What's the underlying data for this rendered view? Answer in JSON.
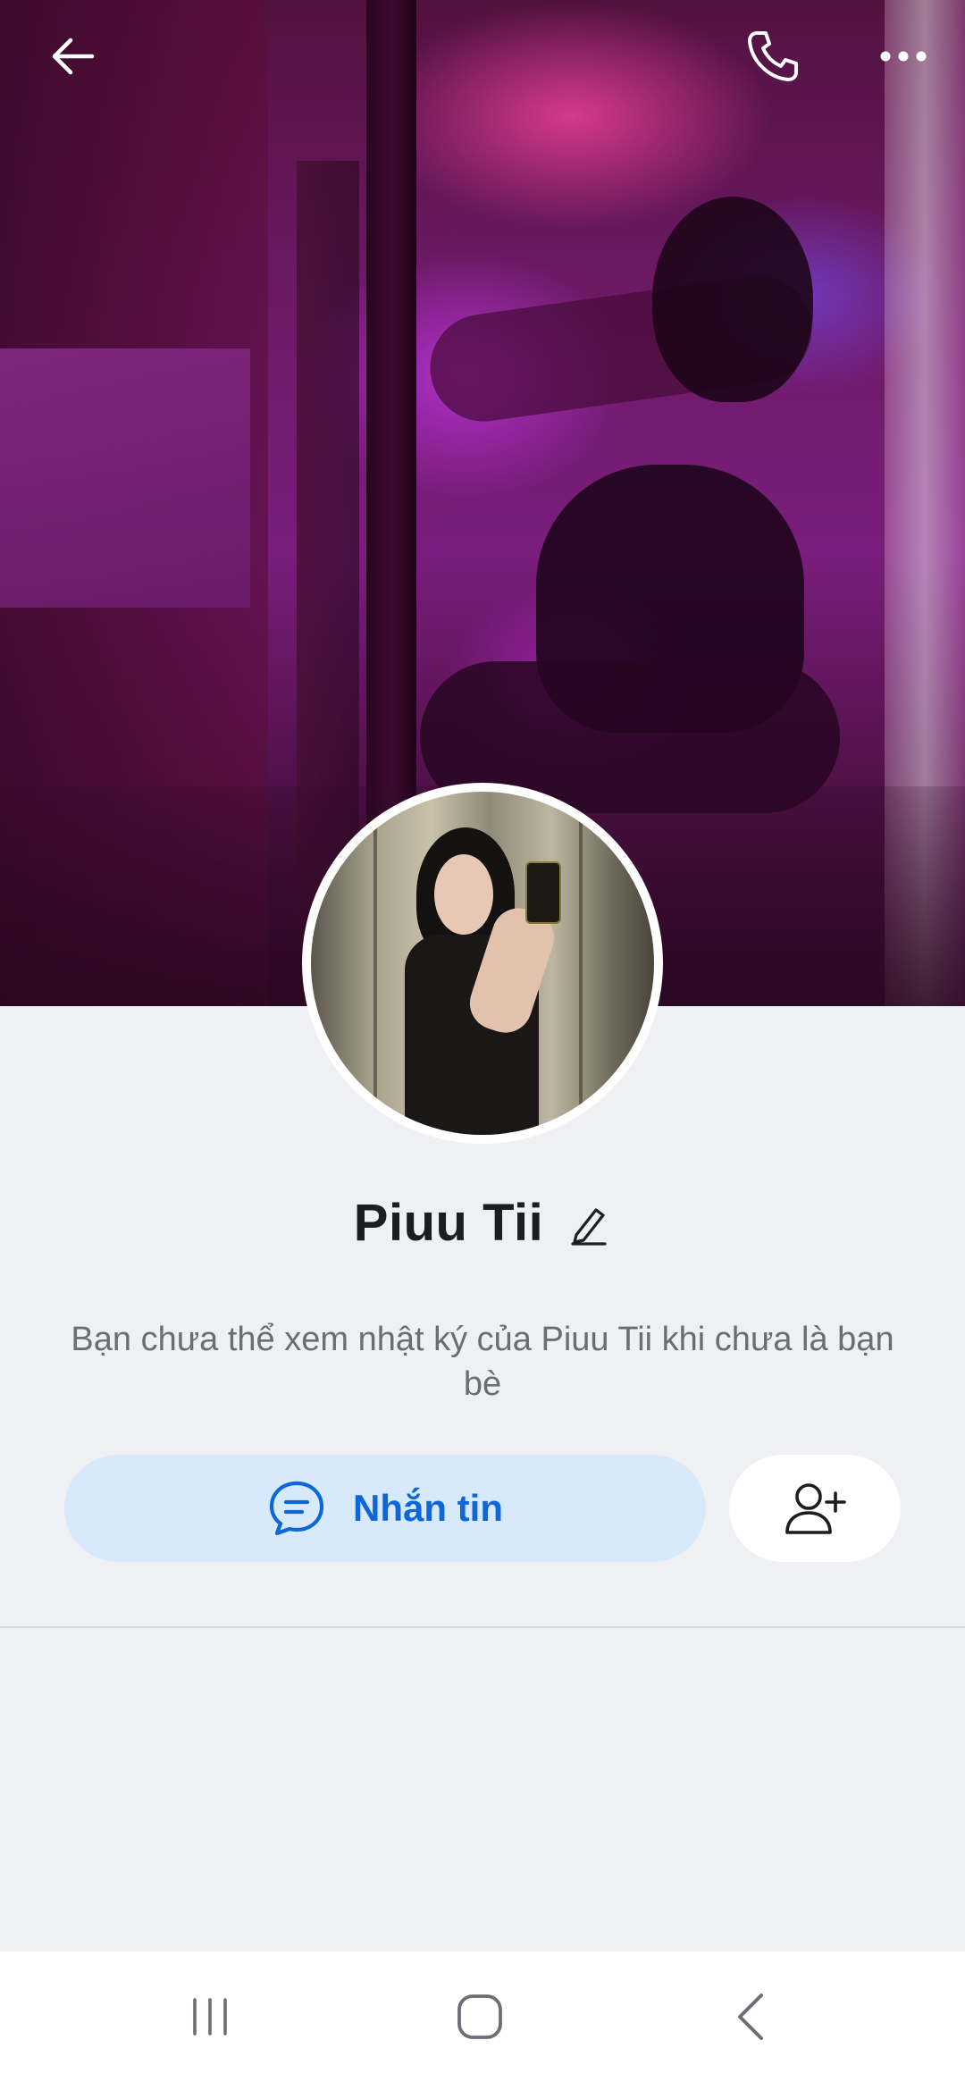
{
  "profile": {
    "name": "Piuu Tii",
    "notice": "Bạn chưa thể xem nhật ký của Piuu Tii khi chưa là bạn bè"
  },
  "actions": {
    "message_label": "Nhắn tin"
  },
  "icons": {
    "back": "arrow-left-icon",
    "call": "phone-icon",
    "more": "more-dots-icon",
    "edit": "pencil-icon",
    "message": "chat-bubble-icon",
    "add_friend": "add-friend-icon",
    "nav_recent": "recent-apps-icon",
    "nav_home": "home-icon",
    "nav_back": "nav-back-icon"
  },
  "colors": {
    "accent": "#0d67d9",
    "message_button_bg": "#d9e9fc",
    "page_bg": "#eff0f4",
    "text_primary": "#1b1d21",
    "text_secondary": "#6a6e74"
  }
}
